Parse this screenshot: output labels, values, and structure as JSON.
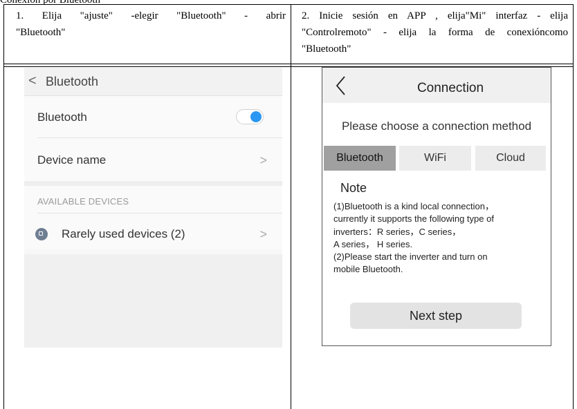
{
  "header_stub": "Conexión por Bluetooth",
  "steps": [
    {
      "text_lines": [
        "1. Elija \"ajuste\" -elegir \"Bluetooth\" - abrir",
        "\"Bluetooth\""
      ]
    },
    {
      "text_lines": [
        "2. Inicie sesión en APP , elija\"Mi\" interfaz - elija",
        "\"Controlremoto\" - elija la forma de conexióncomo",
        "\"Bluetooth\""
      ]
    }
  ],
  "phone_settings": {
    "back_symbol": "<",
    "title": "Bluetooth",
    "bluetooth_label": "Bluetooth",
    "bluetooth_enabled": true,
    "device_name_label": "Device name",
    "section_label": "AVAILABLE DEVICES",
    "rare_devices_label": "Rarely used devices (2)",
    "chevron": ">",
    "accent_color": "#2a97f2",
    "icons": [
      "device-icon",
      "toggle-icon",
      "chevron-right-icon"
    ]
  },
  "app_connection": {
    "title": "Connection",
    "prompt": "Please choose a connection method",
    "tabs": [
      {
        "label": "Bluetooth",
        "active": true
      },
      {
        "label": "WiFi",
        "active": false
      },
      {
        "label": "Cloud",
        "active": false
      }
    ],
    "note_title": "Note",
    "note_lines": [
      "(1)Bluetooth is a kind local connection，",
      "currently it supports the following type of",
      "inverters：R series，C series，",
      "A series， H series.",
      "(2)Please start the inverter and turn on",
      "mobile Bluetooth."
    ],
    "next_button": "Next step",
    "icons": [
      "back-arrow-icon"
    ]
  }
}
